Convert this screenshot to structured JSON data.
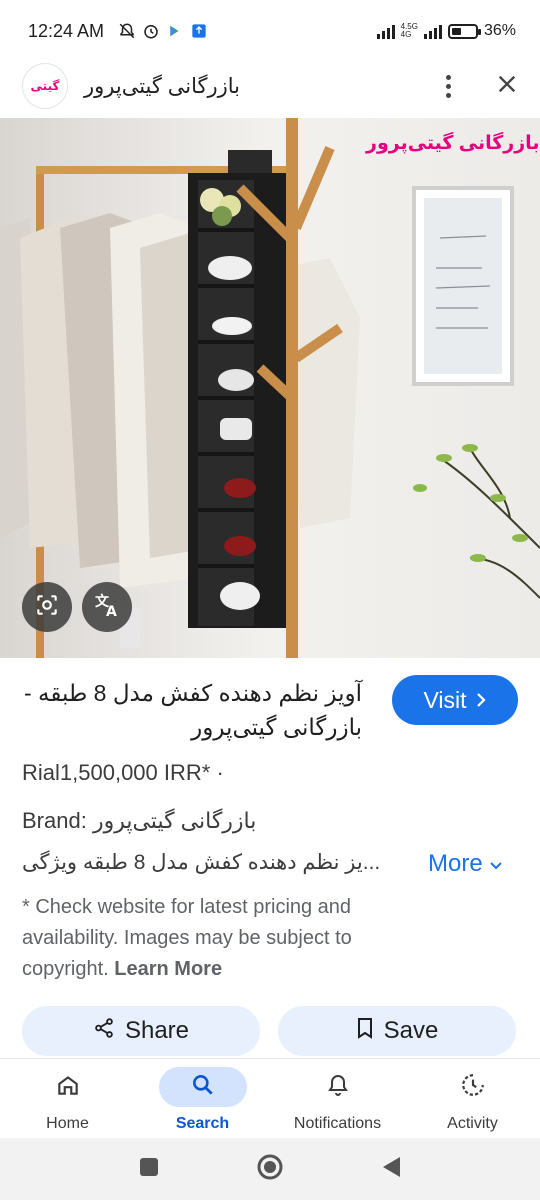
{
  "status_bar": {
    "time": "12:24 AM",
    "network_label_top": "4.5G",
    "network_label_bottom": "4G",
    "battery_percent": "36%",
    "battery_level": 0.36
  },
  "header": {
    "site_logo_text": "گیتی",
    "site_name": "بازرگانی گیتی‌پرور",
    "menu_icon": "more-vert-icon",
    "close_icon": "close-icon"
  },
  "hero": {
    "watermark_text": "بازرگانی گیتی‌پرور",
    "lens_icon": "lens-icon",
    "translate_icon": "translate-icon"
  },
  "result": {
    "title": "آویز نظم دهنده کفش مدل 8 طبقه - بازرگانی گیتی‌پرور",
    "visit_label": "Visit",
    "price": "Rial1,500,000 IRR* ·",
    "brand_label": "Brand:",
    "brand_value": "بازرگانی گیتی‌پرور",
    "description": "...یز نظم دهنده کفش مدل 8 طبقه ویژگی",
    "more_label": "More",
    "disclaimer": "* Check website for latest pricing and availability. Images may be subject to copyright.",
    "learn_more_label": "Learn More",
    "share_label": "Share",
    "save_label": "Save"
  },
  "bottom_nav": [
    {
      "label": "Home",
      "icon": "home-icon",
      "active": false
    },
    {
      "label": "Search",
      "icon": "search-icon",
      "active": true
    },
    {
      "label": "Notifications",
      "icon": "bell-icon",
      "active": false
    },
    {
      "label": "Activity",
      "icon": "activity-icon",
      "active": false
    }
  ],
  "colors": {
    "accent": "#1a73e8",
    "chip_bg": "#e8f0fe",
    "active_nav_bg": "#d3e3fd"
  }
}
